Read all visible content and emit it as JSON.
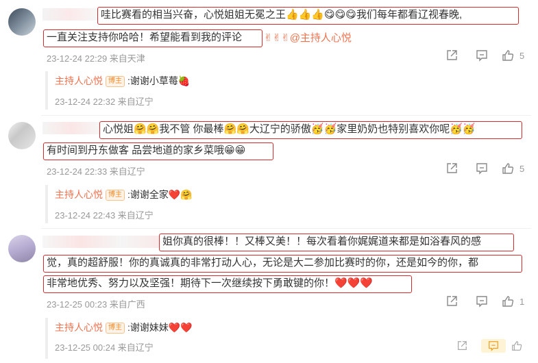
{
  "comments": [
    {
      "lines": [
        "哇比赛看的相当兴奋，心悦姐姐无冕之王👍👍👍😋😋😋我们每年都看辽视春晚,",
        "一直关注支持你哈哈！希望能看到我的评论"
      ],
      "trailing": "✌✌✌@主持人心悦",
      "meta": "23-12-24 22:29 来自天津",
      "likes": "5",
      "reply": {
        "name": "主持人心悦",
        "badge": "博主",
        "text": ":谢谢小草莓🍓",
        "meta": "23-12-24 22:32 来自辽宁"
      }
    },
    {
      "lines": [
        "心悦姐🤗🤗我不管 你最棒🤗🤗大辽宁的骄傲🥳🥳家里奶奶也特别喜欢你呢🥳🥳",
        "有时间到丹东做客 品尝地道的家乡菜哦😁😁"
      ],
      "trailing": "",
      "meta": "23-12-24 22:33 来自辽宁",
      "likes": "5",
      "reply": {
        "name": "主持人心悦",
        "badge": "博主",
        "text": ":谢谢全家❤️🤗",
        "meta": "23-12-24 22:43 来自辽宁"
      }
    },
    {
      "lines": [
        "姐你真的很棒！！又棒又美！！每次看着你娓娓道来都是如浴春风的感",
        "觉，真的超舒服！你的真诚真的非常打动人心，无论是大二参加比赛时的你，还是如今的你，都",
        "非常地优秀、努力以及坚强！期待下一次继续按下勇敢键的你！❤️❤️❤️"
      ],
      "trailing": "",
      "meta": "23-12-25 00:23 来自广西",
      "likes": "1",
      "reply": {
        "name": "主持人心悦",
        "badge": "博主",
        "text": ":谢谢妹妹❤️❤️",
        "meta": "23-12-25 00:24 来自辽宁"
      }
    }
  ],
  "icons": [
    "share-icon",
    "comment-icon",
    "like-icon"
  ],
  "colors": {
    "highlight": "#d42a2a",
    "reply_name": "#eb7350",
    "meta": "#999999"
  }
}
